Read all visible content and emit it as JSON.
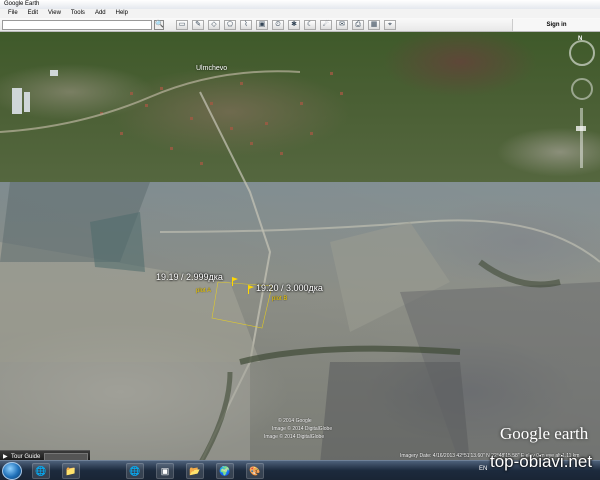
{
  "window": {
    "title": "Google Earth"
  },
  "menu": [
    "File",
    "Edit",
    "View",
    "Tools",
    "Add",
    "Help"
  ],
  "toolbar": {
    "search_value": "",
    "search_button": "🔍",
    "icons": [
      "▭",
      "✎",
      "◇",
      "⬠",
      "⌇",
      "▣",
      "⏲",
      "✱",
      "☾",
      "☄",
      "✉",
      "⎙",
      "▦",
      "⌖"
    ],
    "signin_label": "Sign in"
  },
  "map": {
    "village_label": "Ulmchevo",
    "plot_a": {
      "label": "19.19 / 2.999дка",
      "name": "plot A"
    },
    "plot_b": {
      "label": "19.20 / 3.000дка",
      "name": "plot B"
    },
    "imagery_lines": [
      "© 2014 Google",
      "Image © 2014 DigitalGlobe",
      "Image © 2014 DigitalGlobe"
    ],
    "status_text": "Imagery Date: 4/16/2013  42°51'13.60\" N  22°48'15.58\" E  elev 0 m  eye alt 1.11 km",
    "logo": "Google earth",
    "nav_north": "N"
  },
  "tour_guide": {
    "label": "Tour Guide",
    "arrow": "▶"
  },
  "taskbar": {
    "buttons": [
      "🌐",
      "📁",
      "📂",
      "▣",
      "🌍",
      "🎨"
    ],
    "language": "EN"
  },
  "watermark": "top-obiavi.net"
}
